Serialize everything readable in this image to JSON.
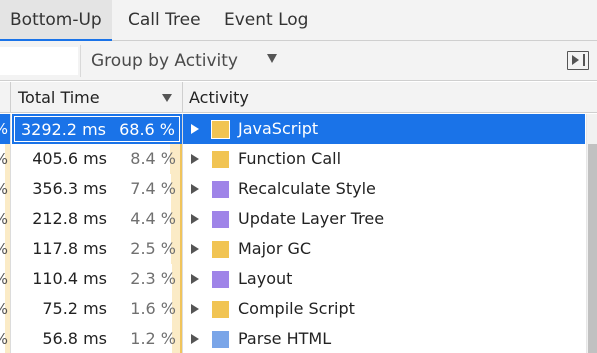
{
  "tabs": [
    {
      "label": "Bottom-Up",
      "active": true
    },
    {
      "label": "Call Tree",
      "active": false
    },
    {
      "label": "Event Log",
      "active": false
    }
  ],
  "toolbar": {
    "filter_value": "",
    "group_by": "Group by Activity"
  },
  "columns": {
    "self_time_glyph": "%",
    "total_time": "Total Time",
    "activity": "Activity"
  },
  "colors": {
    "scripting": "#f1c453",
    "rendering": "#9f84e8",
    "loading": "#7aa5e8",
    "selection": "#1a73e8",
    "heat": "#fbebc6"
  },
  "rows": [
    {
      "total_ms": "3292.2 ms",
      "total_pct": "68.6 %",
      "activity": "JavaScript",
      "color": "#f1c453",
      "selected": true,
      "share": 0.686
    },
    {
      "total_ms": "405.6 ms",
      "total_pct": "8.4 %",
      "activity": "Function Call",
      "color": "#f1c453",
      "selected": false,
      "share": 0.084
    },
    {
      "total_ms": "356.3 ms",
      "total_pct": "7.4 %",
      "activity": "Recalculate Style",
      "color": "#9f84e8",
      "selected": false,
      "share": 0.074
    },
    {
      "total_ms": "212.8 ms",
      "total_pct": "4.4 %",
      "activity": "Update Layer Tree",
      "color": "#9f84e8",
      "selected": false,
      "share": 0.044
    },
    {
      "total_ms": "117.8 ms",
      "total_pct": "2.5 %",
      "activity": "Major GC",
      "color": "#f1c453",
      "selected": false,
      "share": 0.025
    },
    {
      "total_ms": "110.4 ms",
      "total_pct": "2.3 %",
      "activity": "Layout",
      "color": "#9f84e8",
      "selected": false,
      "share": 0.023
    },
    {
      "total_ms": "75.2 ms",
      "total_pct": "1.6 %",
      "activity": "Compile Script",
      "color": "#f1c453",
      "selected": false,
      "share": 0.016
    },
    {
      "total_ms": "56.8 ms",
      "total_pct": "1.2 %",
      "activity": "Parse HTML",
      "color": "#7aa5e8",
      "selected": false,
      "share": 0.012
    }
  ]
}
